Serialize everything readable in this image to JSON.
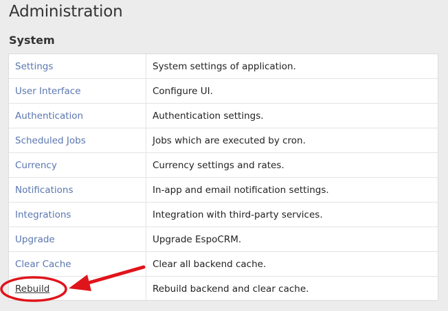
{
  "header": {
    "title": "Administration"
  },
  "section": {
    "title": "System"
  },
  "rows": [
    {
      "label": "Settings",
      "description": "System settings of application."
    },
    {
      "label": "User Interface",
      "description": "Configure UI."
    },
    {
      "label": "Authentication",
      "description": "Authentication settings."
    },
    {
      "label": "Scheduled Jobs",
      "description": "Jobs which are executed by cron."
    },
    {
      "label": "Currency",
      "description": "Currency settings and rates."
    },
    {
      "label": "Notifications",
      "description": "In-app and email notification settings."
    },
    {
      "label": "Integrations",
      "description": "Integration with third-party services."
    },
    {
      "label": "Upgrade",
      "description": "Upgrade EspoCRM."
    },
    {
      "label": "Clear Cache",
      "description": "Clear all backend cache."
    },
    {
      "label": "Rebuild",
      "description": "Rebuild backend and clear cache."
    }
  ],
  "colors": {
    "link": "#5a76b0",
    "annotation": "#e0141b",
    "background": "#ececec"
  }
}
